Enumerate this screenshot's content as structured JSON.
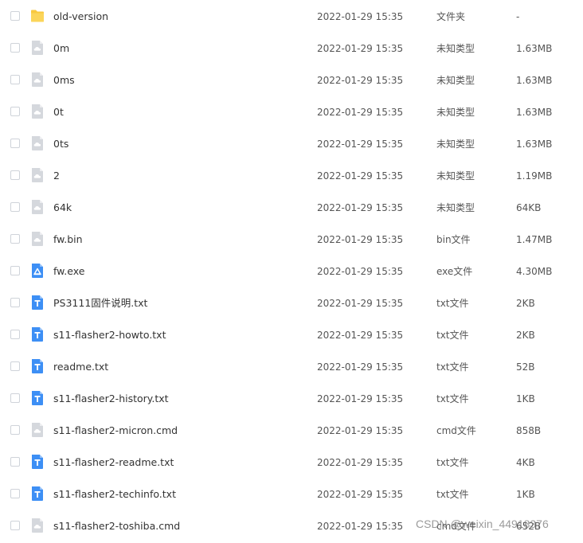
{
  "colors": {
    "folder": "#f9c940",
    "unknown_file": "#d5d8dd",
    "exe_file": "#3d8ff5",
    "txt_file": "#3d8ff5"
  },
  "files": [
    {
      "name": "old-version",
      "date": "2022-01-29 15:35",
      "type": "文件夹",
      "size": "-",
      "icon": "folder-icon"
    },
    {
      "name": "0m",
      "date": "2022-01-29 15:35",
      "type": "未知类型",
      "size": "1.63MB",
      "icon": "unknown-file-icon"
    },
    {
      "name": "0ms",
      "date": "2022-01-29 15:35",
      "type": "未知类型",
      "size": "1.63MB",
      "icon": "unknown-file-icon"
    },
    {
      "name": "0t",
      "date": "2022-01-29 15:35",
      "type": "未知类型",
      "size": "1.63MB",
      "icon": "unknown-file-icon"
    },
    {
      "name": "0ts",
      "date": "2022-01-29 15:35",
      "type": "未知类型",
      "size": "1.63MB",
      "icon": "unknown-file-icon"
    },
    {
      "name": "2",
      "date": "2022-01-29 15:35",
      "type": "未知类型",
      "size": "1.19MB",
      "icon": "unknown-file-icon"
    },
    {
      "name": "64k",
      "date": "2022-01-29 15:35",
      "type": "未知类型",
      "size": "64KB",
      "icon": "unknown-file-icon"
    },
    {
      "name": "fw.bin",
      "date": "2022-01-29 15:35",
      "type": "bin文件",
      "size": "1.47MB",
      "icon": "unknown-file-icon"
    },
    {
      "name": "fw.exe",
      "date": "2022-01-29 15:35",
      "type": "exe文件",
      "size": "4.30MB",
      "icon": "exe-file-icon"
    },
    {
      "name": "PS3111固件说明.txt",
      "date": "2022-01-29 15:35",
      "type": "txt文件",
      "size": "2KB",
      "icon": "text-file-icon"
    },
    {
      "name": "s11-flasher2-howto.txt",
      "date": "2022-01-29 15:35",
      "type": "txt文件",
      "size": "2KB",
      "icon": "text-file-icon"
    },
    {
      "name": "readme.txt",
      "date": "2022-01-29 15:35",
      "type": "txt文件",
      "size": "52B",
      "icon": "text-file-icon"
    },
    {
      "name": "s11-flasher2-history.txt",
      "date": "2022-01-29 15:35",
      "type": "txt文件",
      "size": "1KB",
      "icon": "text-file-icon"
    },
    {
      "name": "s11-flasher2-micron.cmd",
      "date": "2022-01-29 15:35",
      "type": "cmd文件",
      "size": "858B",
      "icon": "unknown-file-icon"
    },
    {
      "name": "s11-flasher2-readme.txt",
      "date": "2022-01-29 15:35",
      "type": "txt文件",
      "size": "4KB",
      "icon": "text-file-icon"
    },
    {
      "name": "s11-flasher2-techinfo.txt",
      "date": "2022-01-29 15:35",
      "type": "txt文件",
      "size": "1KB",
      "icon": "text-file-icon"
    },
    {
      "name": "s11-flasher2-toshiba.cmd",
      "date": "2022-01-29 15:35",
      "type": "cmd文件",
      "size": "652B",
      "icon": "unknown-file-icon"
    }
  ],
  "watermark": "CSDN @weixin_44918376"
}
